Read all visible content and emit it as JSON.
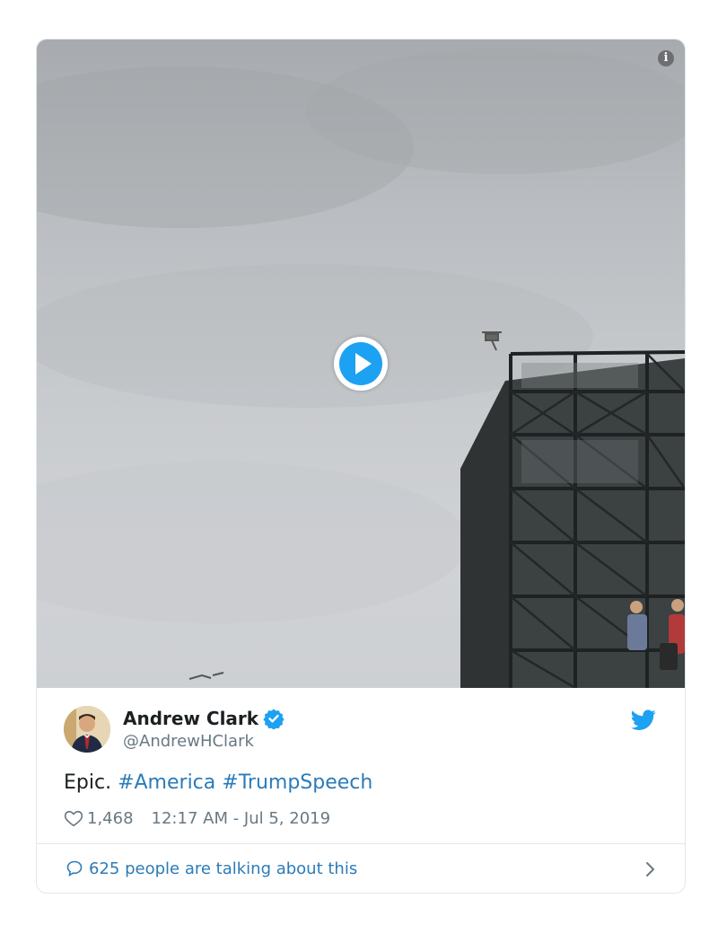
{
  "media": {
    "info_icon": "info-icon",
    "play_icon": "play-icon",
    "info_glyph": "i"
  },
  "author": {
    "display_name": "Andrew Clark",
    "handle": "@AndrewHClark",
    "verified": true,
    "avatar_icon": "avatar"
  },
  "tweet": {
    "text_plain": "Epic.",
    "hashtags": [
      "#America",
      "#TrumpSpeech"
    ]
  },
  "meta": {
    "likes": "1,468",
    "timestamp": "12:17 AM - Jul 5, 2019"
  },
  "footer": {
    "talking_text": "625 people are talking about this"
  },
  "colors": {
    "accent": "#1da1f2",
    "link": "#2b7bb9",
    "muted": "#697882",
    "text": "#1c2022",
    "border": "#e1e8ed"
  }
}
